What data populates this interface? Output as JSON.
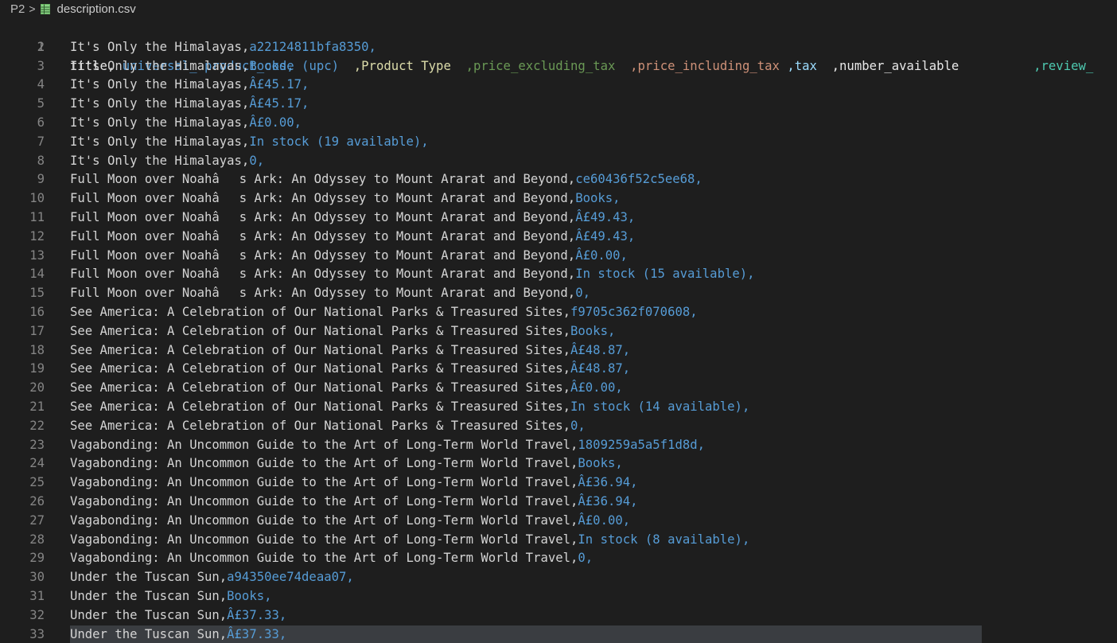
{
  "breadcrumb": {
    "folder": "P2",
    "separator": ">",
    "file": "description.csv",
    "file_icon": "csv-table-icon"
  },
  "colors": {
    "background": "#1e1e1e",
    "line_number": "#858585",
    "title_text": "#d4d4d4",
    "value_text": "#569cd6",
    "current_line": "#3a3d41"
  },
  "editor": {
    "header": {
      "number": "1",
      "cols": [
        "title,",
        " universal_ product_code (upc)  ",
        ",Product Type  ",
        ",price_excluding_tax  ",
        ",price_including_tax ",
        ",tax  ",
        ",number_available          ",
        ",review_"
      ]
    },
    "lines": [
      {
        "n": "2",
        "title": "It's Only the Himalayas,",
        "value": "a22124811bfa8350,"
      },
      {
        "n": "3",
        "title": "It's Only the Himalayas,",
        "value": "Books,"
      },
      {
        "n": "4",
        "title": "It's Only the Himalayas,",
        "value": "Â£45.17,"
      },
      {
        "n": "5",
        "title": "It's Only the Himalayas,",
        "value": "Â£45.17,"
      },
      {
        "n": "6",
        "title": "It's Only the Himalayas,",
        "value": "Â£0.00,"
      },
      {
        "n": "7",
        "title": "It's Only the Himalayas,",
        "value": "In stock (19 available),"
      },
      {
        "n": "8",
        "title": "It's Only the Himalayas,",
        "value": "0,"
      },
      {
        "n": "9",
        "title": "Full Moon over Noahâs Ark: An Odyssey to Mount Ararat and Beyond,",
        "value": "ce60436f52c5ee68,"
      },
      {
        "n": "10",
        "title": "Full Moon over Noahâs Ark: An Odyssey to Mount Ararat and Beyond,",
        "value": "Books,"
      },
      {
        "n": "11",
        "title": "Full Moon over Noahâs Ark: An Odyssey to Mount Ararat and Beyond,",
        "value": "Â£49.43,"
      },
      {
        "n": "12",
        "title": "Full Moon over Noahâs Ark: An Odyssey to Mount Ararat and Beyond,",
        "value": "Â£49.43,"
      },
      {
        "n": "13",
        "title": "Full Moon over Noahâs Ark: An Odyssey to Mount Ararat and Beyond,",
        "value": "Â£0.00,"
      },
      {
        "n": "14",
        "title": "Full Moon over Noahâs Ark: An Odyssey to Mount Ararat and Beyond,",
        "value": "In stock (15 available),"
      },
      {
        "n": "15",
        "title": "Full Moon over Noahâs Ark: An Odyssey to Mount Ararat and Beyond,",
        "value": "0,"
      },
      {
        "n": "16",
        "title": "See America: A Celebration of Our National Parks & Treasured Sites,",
        "value": "f9705c362f070608,"
      },
      {
        "n": "17",
        "title": "See America: A Celebration of Our National Parks & Treasured Sites,",
        "value": "Books,"
      },
      {
        "n": "18",
        "title": "See America: A Celebration of Our National Parks & Treasured Sites,",
        "value": "Â£48.87,"
      },
      {
        "n": "19",
        "title": "See America: A Celebration of Our National Parks & Treasured Sites,",
        "value": "Â£48.87,"
      },
      {
        "n": "20",
        "title": "See America: A Celebration of Our National Parks & Treasured Sites,",
        "value": "Â£0.00,"
      },
      {
        "n": "21",
        "title": "See America: A Celebration of Our National Parks & Treasured Sites,",
        "value": "In stock (14 available),"
      },
      {
        "n": "22",
        "title": "See America: A Celebration of Our National Parks & Treasured Sites,",
        "value": "0,"
      },
      {
        "n": "23",
        "title": "Vagabonding: An Uncommon Guide to the Art of Long-Term World Travel,",
        "value": "1809259a5a5f1d8d,"
      },
      {
        "n": "24",
        "title": "Vagabonding: An Uncommon Guide to the Art of Long-Term World Travel,",
        "value": "Books,"
      },
      {
        "n": "25",
        "title": "Vagabonding: An Uncommon Guide to the Art of Long-Term World Travel,",
        "value": "Â£36.94,"
      },
      {
        "n": "26",
        "title": "Vagabonding: An Uncommon Guide to the Art of Long-Term World Travel,",
        "value": "Â£36.94,"
      },
      {
        "n": "27",
        "title": "Vagabonding: An Uncommon Guide to the Art of Long-Term World Travel,",
        "value": "Â£0.00,"
      },
      {
        "n": "28",
        "title": "Vagabonding: An Uncommon Guide to the Art of Long-Term World Travel,",
        "value": "In stock (8 available),"
      },
      {
        "n": "29",
        "title": "Vagabonding: An Uncommon Guide to the Art of Long-Term World Travel,",
        "value": "0,"
      },
      {
        "n": "30",
        "title": "Under the Tuscan Sun,",
        "value": "a94350ee74deaa07,"
      },
      {
        "n": "31",
        "title": "Under the Tuscan Sun,",
        "value": "Books,"
      },
      {
        "n": "32",
        "title": "Under the Tuscan Sun,",
        "value": "Â£37.33,"
      },
      {
        "n": "33",
        "title": "Under the Tuscan Sun,",
        "value": "Â£37.33,",
        "current": true
      }
    ]
  }
}
